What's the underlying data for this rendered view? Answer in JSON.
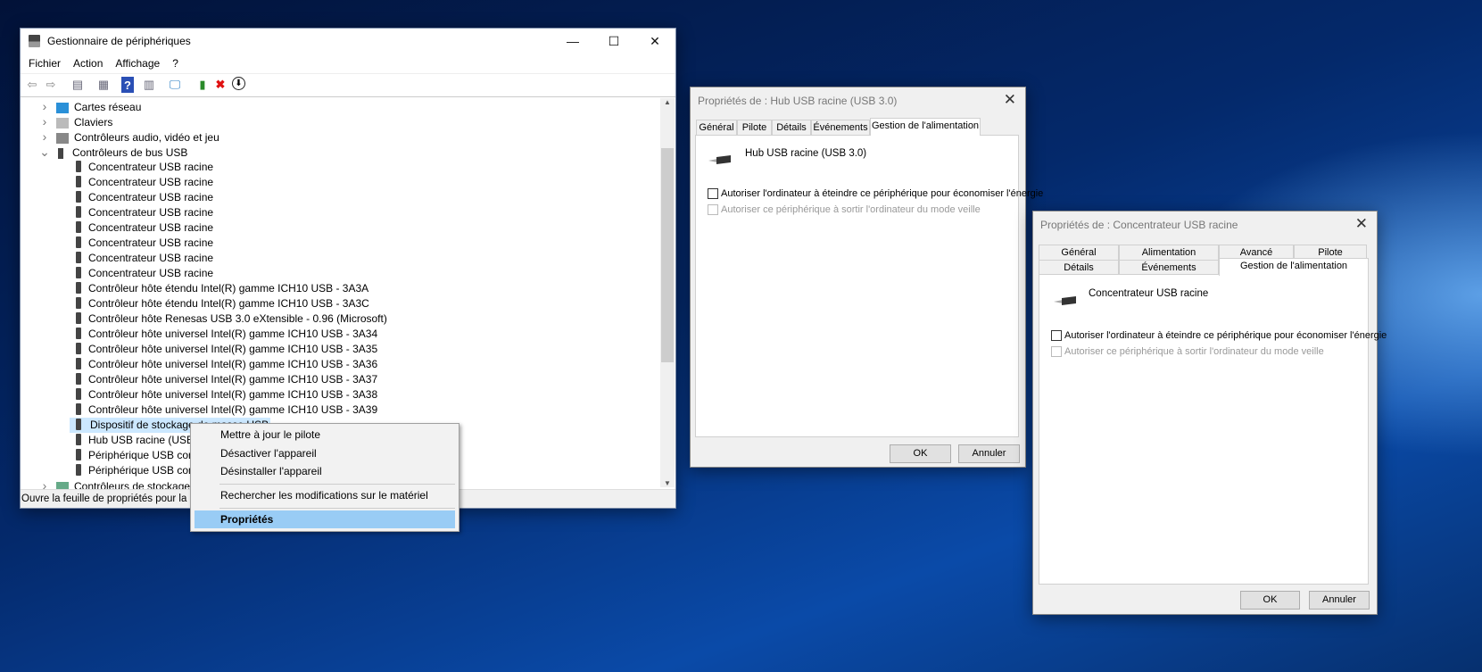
{
  "device_manager": {
    "title": "Gestionnaire de périphériques",
    "menu": [
      "Fichier",
      "Action",
      "Affichage",
      "?"
    ],
    "toolbar_icons": [
      "back-arrow-icon",
      "forward-arrow-icon",
      "show-hide-console-tree-icon",
      "properties-sheet-icon",
      "help-icon",
      "action-pane-icon",
      "scan-hardware-icon",
      "update-driver-icon",
      "uninstall-icon",
      "disable-device-icon"
    ],
    "tree": [
      {
        "label": "Cartes réseau",
        "level": 0,
        "expander": "collapsed",
        "icon": "network-adapter-icon"
      },
      {
        "label": "Claviers",
        "level": 0,
        "expander": "collapsed",
        "icon": "keyboard-icon"
      },
      {
        "label": "Contrôleurs audio, vidéo et jeu",
        "level": 0,
        "expander": "collapsed",
        "icon": "speaker-icon"
      },
      {
        "label": "Contrôleurs de bus USB",
        "level": 0,
        "expander": "expanded",
        "icon": "usb-icon"
      },
      {
        "label": "Concentrateur USB racine",
        "level": 1
      },
      {
        "label": "Concentrateur USB racine",
        "level": 1
      },
      {
        "label": "Concentrateur USB racine",
        "level": 1
      },
      {
        "label": "Concentrateur USB racine",
        "level": 1
      },
      {
        "label": "Concentrateur USB racine",
        "level": 1
      },
      {
        "label": "Concentrateur USB racine",
        "level": 1
      },
      {
        "label": "Concentrateur USB racine",
        "level": 1
      },
      {
        "label": "Concentrateur USB racine",
        "level": 1
      },
      {
        "label": "Contrôleur hôte étendu Intel(R) gamme ICH10 USB - 3A3A",
        "level": 1
      },
      {
        "label": "Contrôleur hôte étendu Intel(R) gamme ICH10 USB - 3A3C",
        "level": 1
      },
      {
        "label": "Contrôleur hôte Renesas USB 3.0 eXtensible - 0.96 (Microsoft)",
        "level": 1
      },
      {
        "label": "Contrôleur hôte universel Intel(R) gamme ICH10 USB - 3A34",
        "level": 1
      },
      {
        "label": "Contrôleur hôte universel Intel(R) gamme ICH10 USB - 3A35",
        "level": 1
      },
      {
        "label": "Contrôleur hôte universel Intel(R) gamme ICH10 USB - 3A36",
        "level": 1
      },
      {
        "label": "Contrôleur hôte universel Intel(R) gamme ICH10 USB - 3A37",
        "level": 1
      },
      {
        "label": "Contrôleur hôte universel Intel(R) gamme ICH10 USB - 3A38",
        "level": 1
      },
      {
        "label": "Contrôleur hôte universel Intel(R) gamme ICH10 USB - 3A39",
        "level": 1
      },
      {
        "label": "Dispositif de stockage de masse USB",
        "level": 1,
        "selected": true
      },
      {
        "label": "Hub USB racine (USB 3.0)",
        "level": 1
      },
      {
        "label": "Périphérique USB composite",
        "level": 1
      },
      {
        "label": "Périphérique USB composite",
        "level": 1
      },
      {
        "label": "Contrôleurs de stockage",
        "level": 0,
        "expander": "collapsed",
        "icon": "storage-controller-icon"
      }
    ],
    "status": "Ouvre la feuille de propriétés pour la sélection actuelle."
  },
  "context_menu": {
    "items": [
      "Mettre à jour le pilote",
      "Désactiver l'appareil",
      "Désinstaller l'appareil",
      "Rechercher les modifications sur le matériel",
      "Propriétés"
    ],
    "highlight_color": "#99ccff"
  },
  "dialog1": {
    "title": "Propriétés de : Hub USB racine (USB 3.0)",
    "tabs": [
      "Général",
      "Pilote",
      "Détails",
      "Événements",
      "Gestion de l'alimentation"
    ],
    "device_name": "Hub USB racine (USB 3.0)",
    "check1": "Autoriser l'ordinateur à éteindre ce périphérique pour économiser l'énergie",
    "check2": "Autoriser ce périphérique à sortir l'ordinateur du mode veille",
    "ok": "OK",
    "cancel": "Annuler"
  },
  "dialog2": {
    "title": "Propriétés de : Concentrateur USB racine",
    "tabs_row1": [
      "Général",
      "Alimentation",
      "Avancé",
      "Pilote"
    ],
    "tabs_row2": [
      "Détails",
      "Événements",
      "Gestion de l'alimentation"
    ],
    "device_name": "Concentrateur USB racine",
    "check1": "Autoriser l'ordinateur à éteindre ce périphérique pour économiser l'énergie",
    "check2": "Autoriser ce périphérique à sortir l'ordinateur du mode veille",
    "ok": "OK",
    "cancel": "Annuler"
  }
}
